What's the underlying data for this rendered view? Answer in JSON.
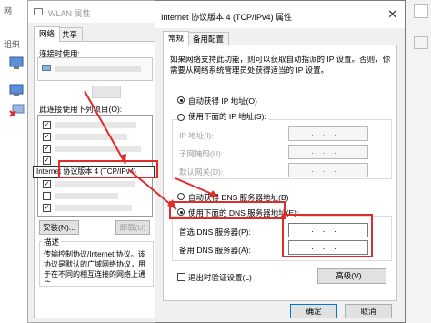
{
  "background": {
    "title_fragment": "网",
    "toolbar_fragment": "组织"
  },
  "wlan": {
    "title": "WLAN 属性",
    "tabs": [
      "网络",
      "共享"
    ],
    "connect_using_label": "连接时使用:",
    "items_label": "此连接使用下列项目(O):",
    "tcpip_item": "Internet 协议版本 4 (TCP/IPv4)",
    "buttons": {
      "install": "安装(N)...",
      "uninstall": "卸载(U)"
    },
    "description_label": "描述",
    "description_text": "传输控制协议/Internet 协议。该协议是默认的广域网络协议，用于在不同的相互连接的网络上通信。"
  },
  "dialog": {
    "title": "Internet 协议版本 4 (TCP/IPv4) 属性",
    "close_glyph": "✕",
    "tabs": [
      "常规",
      "备用配置"
    ],
    "intro": "如果网络支持此功能，则可以获取自动指派的 IP 设置。否则，你需要从网络系统管理员处获得适当的 IP 设置。",
    "ip_auto": "自动获得 IP 地址(O)",
    "ip_manual": "使用下面的 IP 地址(S):",
    "ip_fields": {
      "ip_address": "IP 地址(I):",
      "subnet_mask": "子网掩码(U):",
      "gateway": "默认网关(D):"
    },
    "dns_auto": "自动获得 DNS 服务器地址(B)",
    "dns_manual": "使用下面的 DNS 服务器地址(E):",
    "dns_fields": {
      "preferred": "首选 DNS 服务器(P):",
      "alternate": "备用 DNS 服务器(A):"
    },
    "empty_ip": "...",
    "validate_on_exit": "退出时验证设置(L)",
    "advanced_button": "高级(V)...",
    "ok_button": "确定",
    "cancel_button": "取消"
  },
  "state": {
    "ip_mode": "auto",
    "dns_mode": "manual",
    "validate_checked": false
  },
  "colors": {
    "annotation_red": "#e02b2b",
    "window_bg": "#f0f0f0",
    "panel_bg": "#ffffff"
  }
}
